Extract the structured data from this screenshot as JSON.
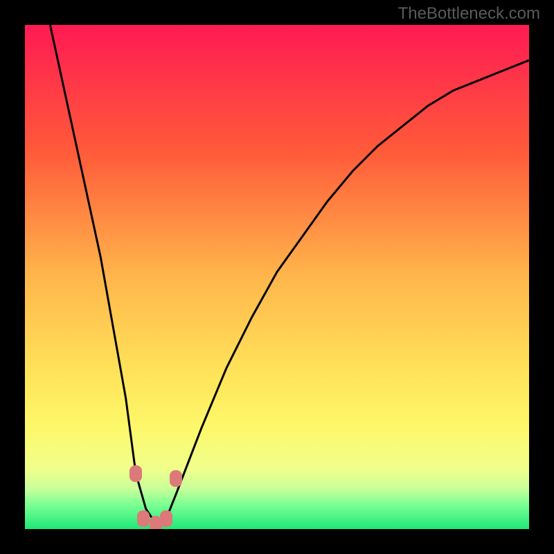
{
  "watermark": "TheBottleneck.com",
  "chart_data": {
    "type": "line",
    "title": "",
    "xlabel": "",
    "ylabel": "",
    "xlim": [
      0,
      100
    ],
    "ylim": [
      0,
      100
    ],
    "series": [
      {
        "name": "curve",
        "x": [
          5,
          10,
          15,
          20,
          22,
          24,
          26,
          28,
          30,
          35,
          40,
          45,
          50,
          55,
          60,
          65,
          70,
          75,
          80,
          85,
          90,
          95,
          100
        ],
        "y": [
          100,
          77,
          54,
          26,
          11,
          4,
          1,
          2,
          7,
          20,
          32,
          42,
          51,
          58,
          65,
          71,
          76,
          80,
          84,
          87,
          89,
          91,
          93
        ]
      }
    ],
    "markers": [
      {
        "x": 22,
        "y": 11
      },
      {
        "x": 23.5,
        "y": 2
      },
      {
        "x": 26,
        "y": 1
      },
      {
        "x": 28,
        "y": 2
      },
      {
        "x": 30,
        "y": 10
      }
    ],
    "gradient_stops": [
      {
        "offset": 0,
        "color": "#ff1a53"
      },
      {
        "offset": 25,
        "color": "#ff5a3a"
      },
      {
        "offset": 50,
        "color": "#ffb64b"
      },
      {
        "offset": 70,
        "color": "#ffe55a"
      },
      {
        "offset": 80,
        "color": "#fdf86b"
      },
      {
        "offset": 88,
        "color": "#f0ff8a"
      },
      {
        "offset": 92,
        "color": "#c9ff9a"
      },
      {
        "offset": 95,
        "color": "#7eff93"
      },
      {
        "offset": 100,
        "color": "#1fe879"
      }
    ],
    "curve_stroke": "#000000",
    "marker_fill": "#db7a79"
  }
}
